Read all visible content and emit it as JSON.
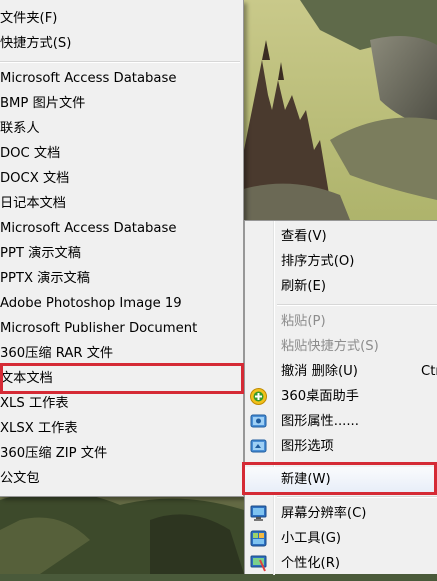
{
  "new_submenu": {
    "items": [
      {
        "label": "文件夹(F)"
      },
      {
        "label": "快捷方式(S)"
      },
      {
        "label": "Microsoft Access Database"
      },
      {
        "label": "BMP 图片文件"
      },
      {
        "label": "联系人"
      },
      {
        "label": "DOC 文档"
      },
      {
        "label": "DOCX 文档"
      },
      {
        "label": "日记本文档"
      },
      {
        "label": "Microsoft Access Database"
      },
      {
        "label": "PPT 演示文稿"
      },
      {
        "label": "PPTX 演示文稿"
      },
      {
        "label": "Adobe Photoshop Image 19"
      },
      {
        "label": "Microsoft Publisher Document"
      },
      {
        "label": "360压缩 RAR 文件"
      },
      {
        "label": "文本文档"
      },
      {
        "label": "XLS 工作表"
      },
      {
        "label": "XLSX 工作表"
      },
      {
        "label": "360压缩 ZIP 文件"
      },
      {
        "label": "公文包"
      }
    ]
  },
  "context_menu": {
    "items": [
      {
        "label": "查看(V)"
      },
      {
        "label": "排序方式(O)"
      },
      {
        "label": "刷新(E)"
      },
      {
        "label": "粘贴(P)"
      },
      {
        "label": "粘贴快捷方式(S)"
      },
      {
        "label": "撤消 删除(U)",
        "shortcut": "Ctr"
      },
      {
        "label": "360桌面助手",
        "icon": "360-desktop-icon"
      },
      {
        "label": "图形属性......",
        "icon": "graphics-properties-icon"
      },
      {
        "label": "图形选项",
        "icon": "graphics-options-icon"
      },
      {
        "label": "新建(W)"
      },
      {
        "label": "屏幕分辨率(C)",
        "icon": "screen-resolution-icon"
      },
      {
        "label": "小工具(G)",
        "icon": "gadgets-icon"
      },
      {
        "label": "个性化(R)",
        "icon": "personalize-icon"
      }
    ]
  },
  "colors": {
    "menu_bg": "#f0f0f0",
    "highlight_box": "#d52a35",
    "disabled_text": "#8d8d8d"
  }
}
